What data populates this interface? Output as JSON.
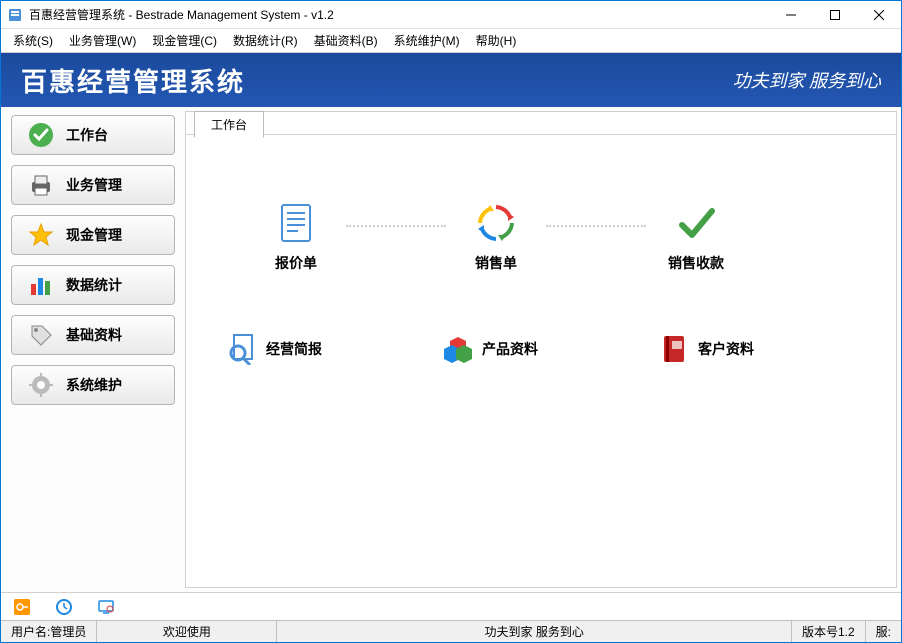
{
  "window": {
    "title": "百惠经营管理系统 - Bestrade Management System - v1.2"
  },
  "menubar": {
    "items": [
      {
        "label": "系统(S)"
      },
      {
        "label": "业务管理(W)"
      },
      {
        "label": "现金管理(C)"
      },
      {
        "label": "数据统计(R)"
      },
      {
        "label": "基础资料(B)"
      },
      {
        "label": "系统维护(M)"
      },
      {
        "label": "帮助(H)"
      }
    ]
  },
  "header": {
    "title": "百惠经营管理系统",
    "slogan": "功夫到家 服务到心"
  },
  "sidebar": {
    "items": [
      {
        "label": "工作台",
        "icon": "check-circle"
      },
      {
        "label": "业务管理",
        "icon": "printer"
      },
      {
        "label": "现金管理",
        "icon": "star"
      },
      {
        "label": "数据统计",
        "icon": "bar-chart"
      },
      {
        "label": "基础资料",
        "icon": "tag"
      },
      {
        "label": "系统维护",
        "icon": "gear"
      }
    ]
  },
  "tab": {
    "active": "工作台"
  },
  "workflow": {
    "items": [
      {
        "label": "报价单",
        "icon": "document"
      },
      {
        "label": "销售单",
        "icon": "recycle"
      },
      {
        "label": "销售收款",
        "icon": "checkmark"
      }
    ]
  },
  "quicklinks": {
    "items": [
      {
        "label": "经营简报",
        "icon": "magnifier-doc"
      },
      {
        "label": "产品资料",
        "icon": "cubes"
      },
      {
        "label": "客户资料",
        "icon": "red-book"
      }
    ]
  },
  "statusbar": {
    "user_label": "用户名:",
    "user_value": "管理员",
    "welcome": "欢迎使用",
    "slogan": "功夫到家 服务到心",
    "version_label": "版本号",
    "version_value": "1.2",
    "server_label": "服:"
  }
}
